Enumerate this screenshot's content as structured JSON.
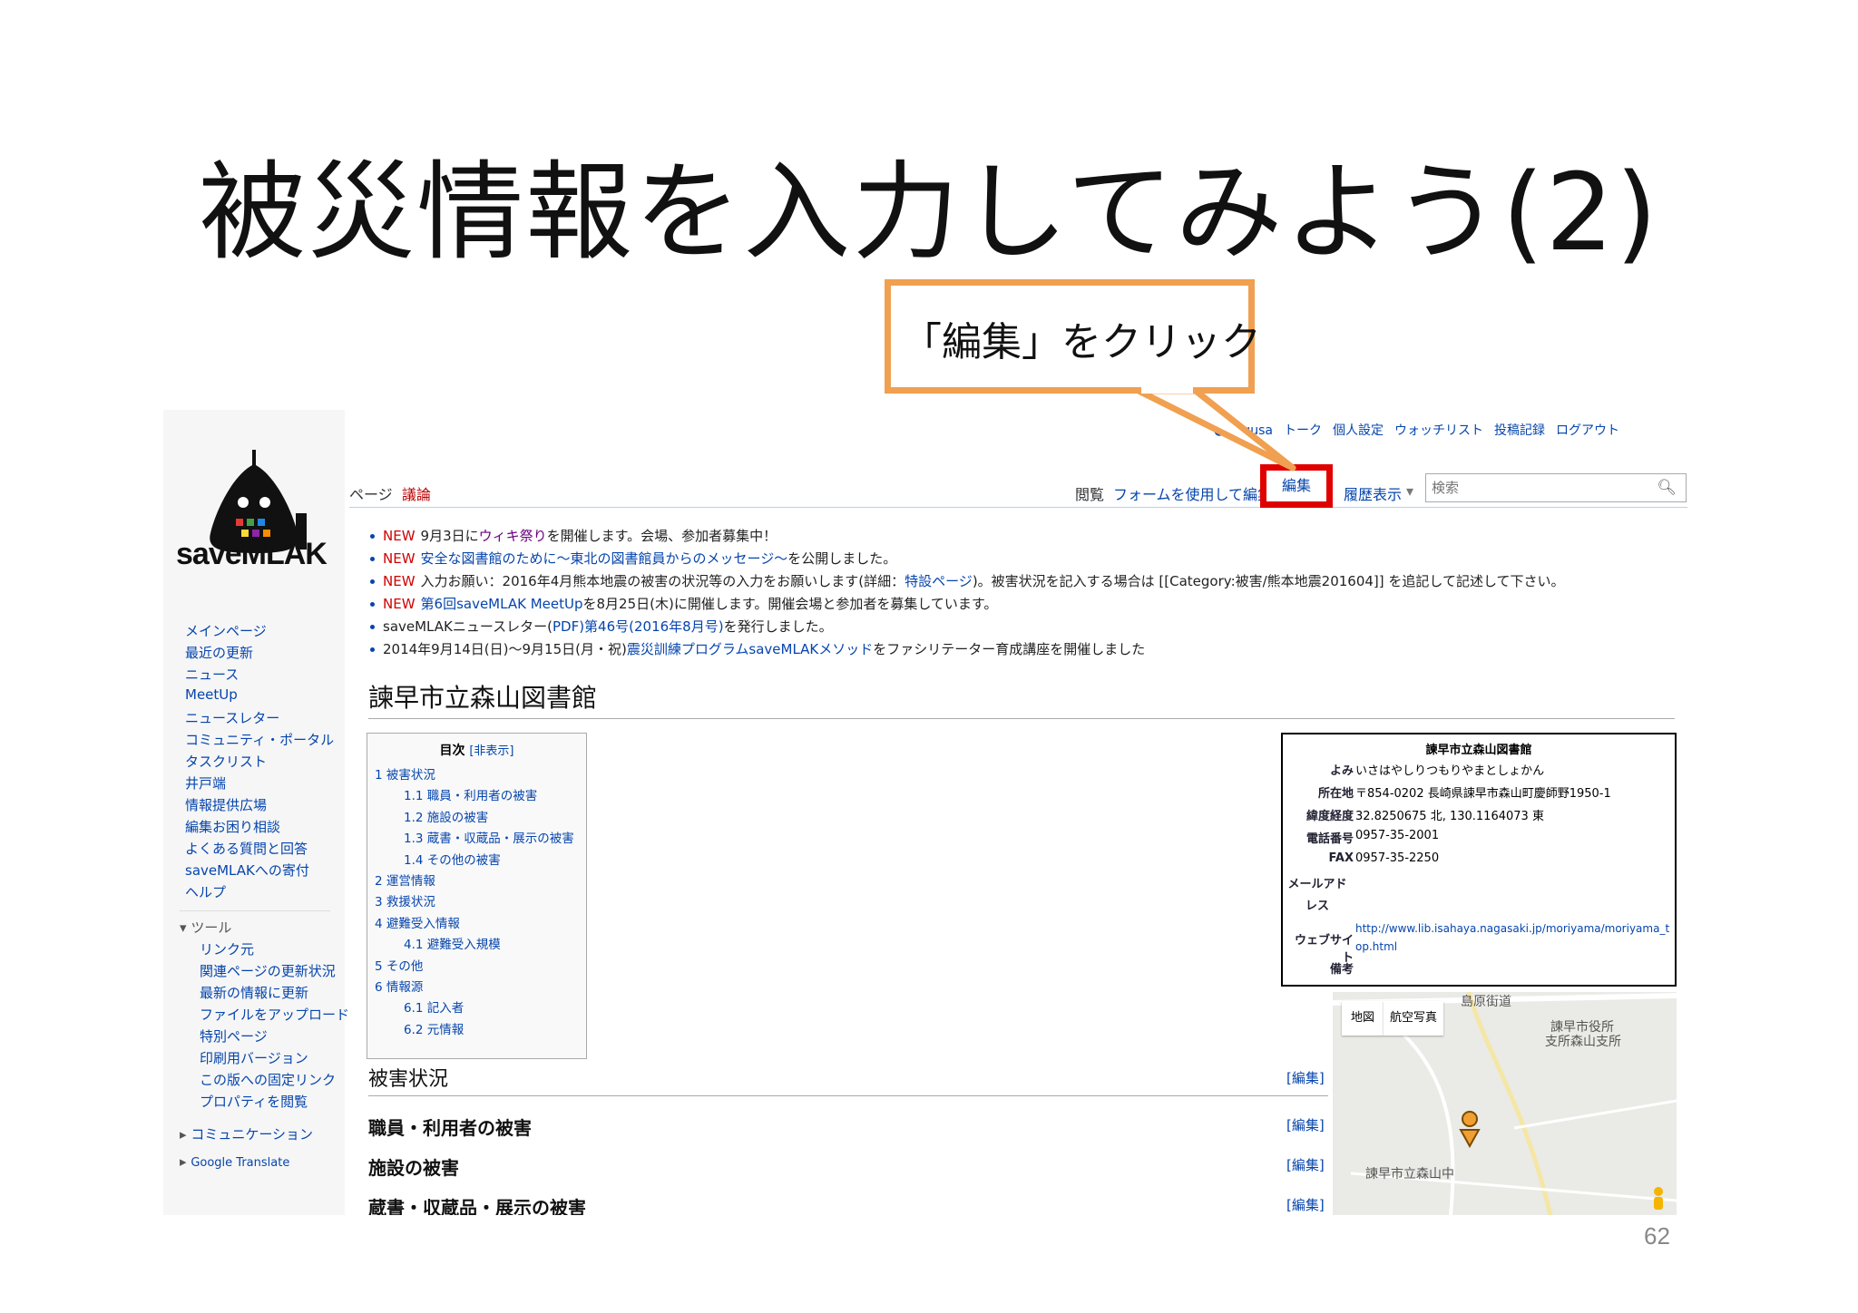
{
  "slide": {
    "title": "被災情報を入力してみよう(2)",
    "page_number": "62",
    "callout": {
      "text": "「編集」をクリック",
      "border_color": "#f0a050"
    },
    "highlight_color": "#e00000"
  },
  "wiki": {
    "logo_text": "saveMLAK",
    "personal": {
      "user": "Yegusa",
      "links": [
        "トーク",
        "個人設定",
        "ウォッチリスト",
        "投稿記録",
        "ログアウト"
      ]
    },
    "sidebar": {
      "nav": [
        "メインページ",
        "最近の更新",
        "ニュース",
        "MeetUp",
        "ニュースレター",
        "コミュニティ・ポータル",
        "タスクリスト",
        "井戸端",
        "情報提供広場",
        "編集お困り相談",
        "よくある質問と回答",
        "saveMLAKへの寄付",
        "ヘルプ"
      ],
      "tools_heading": "ツール",
      "tools": [
        "リンク元",
        "関連ページの更新状況",
        "最新の情報に更新",
        "ファイルをアップロード",
        "特別ページ",
        "印刷用バージョン",
        "この版への固定リンク",
        "プロパティを閲覧"
      ],
      "communication": "コミュニケーション",
      "translate": "Google Translate"
    },
    "tabs": {
      "page": "ページ",
      "discussion": "議論",
      "read": "閲覧",
      "form_edit": "フォームを使用して編集",
      "edit": "編集",
      "history": "履歴表示"
    },
    "search": {
      "placeholder": "検索"
    },
    "news": [
      {
        "new": "NEW",
        "parts": [
          "9月3日に",
          "ウィキ祭り",
          "を開催します。会場、参加者募集中！"
        ]
      },
      {
        "new": "NEW",
        "parts": [
          "",
          "安全な図書館のために〜東北の図書館員からのメッセージ〜",
          "を公開しました。"
        ]
      },
      {
        "new": "NEW",
        "parts": [
          "入力お願い：2016年4月熊本地震の被害の状況等の入力をお願いします(詳細：",
          "特設ページ",
          ")。被害状況を記入する場合は [[Category:被害/熊本地震201604]] を追記して記述して下さい。"
        ]
      },
      {
        "new": "NEW",
        "parts": [
          "",
          "第6回saveMLAK MeetUp",
          "を8月25日(木)に開催します。開催会場と参加者を募集しています。"
        ]
      },
      {
        "new": "",
        "parts": [
          "saveMLAKニュースレター(",
          "PDF)第46号(2016年8月号)",
          "を発行しました。"
        ]
      },
      {
        "new": "",
        "parts": [
          "2014年9月14日(日)〜9月15日(月・祝)",
          "震災訓練プログラムsaveMLAKメソッド",
          "をファシリテーター育成講座を開催しました"
        ]
      }
    ],
    "article_title": "諫早市立森山図書館",
    "toc": {
      "title": "目次",
      "hide": "[非表示]",
      "items": [
        {
          "num": "1",
          "label": "被害状況",
          "level": 1
        },
        {
          "num": "1.1",
          "label": "職員・利用者の被害",
          "level": 2
        },
        {
          "num": "1.2",
          "label": "施設の被害",
          "level": 2
        },
        {
          "num": "1.3",
          "label": "蔵書・収蔵品・展示の被害",
          "level": 2
        },
        {
          "num": "1.4",
          "label": "その他の被害",
          "level": 2
        },
        {
          "num": "2",
          "label": "運営情報",
          "level": 1
        },
        {
          "num": "3",
          "label": "救援状況",
          "level": 1
        },
        {
          "num": "4",
          "label": "避難受入情報",
          "level": 1
        },
        {
          "num": "4.1",
          "label": "避難受入規模",
          "level": 2
        },
        {
          "num": "5",
          "label": "その他",
          "level": 1
        },
        {
          "num": "6",
          "label": "情報源",
          "level": 1
        },
        {
          "num": "6.1",
          "label": "記入者",
          "level": 2
        },
        {
          "num": "6.2",
          "label": "元情報",
          "level": 2
        }
      ]
    },
    "infobox": {
      "title": "諫早市立森山図書館",
      "rows": [
        {
          "label": "よみ",
          "value": "いさはやしりつもりやまとしょかん"
        },
        {
          "label": "所在地",
          "value": "〒854-0202 長崎県諫早市森山町慶師野1950-1"
        },
        {
          "label": "緯度経度",
          "value": "32.8250675 北, 130.1164073 東"
        },
        {
          "label": "電話番号",
          "value": "0957-35-2001"
        },
        {
          "label": "FAX",
          "value": "0957-35-2250"
        },
        {
          "label": "メールアドレス",
          "value": ""
        },
        {
          "label": "ウェブサイト",
          "value": "http://www.lib.isahaya.nagasaki.jp/moriyama/moriyama_top.html"
        },
        {
          "label": "備考",
          "value": ""
        }
      ]
    },
    "map": {
      "buttons": [
        "地図",
        "航空写真"
      ],
      "labels": [
        "島原街道",
        "諫早市役所",
        "支所森山支所",
        "諫早市立森山中"
      ]
    },
    "sections": [
      {
        "title": "被害状況",
        "edit": "[編集]"
      },
      {
        "title": "職員・利用者の被害",
        "edit": "[編集]"
      },
      {
        "title": "施設の被害",
        "edit": "[編集]"
      },
      {
        "title": "蔵書・収蔵品・展示の被害",
        "edit": "[編集]"
      }
    ]
  }
}
